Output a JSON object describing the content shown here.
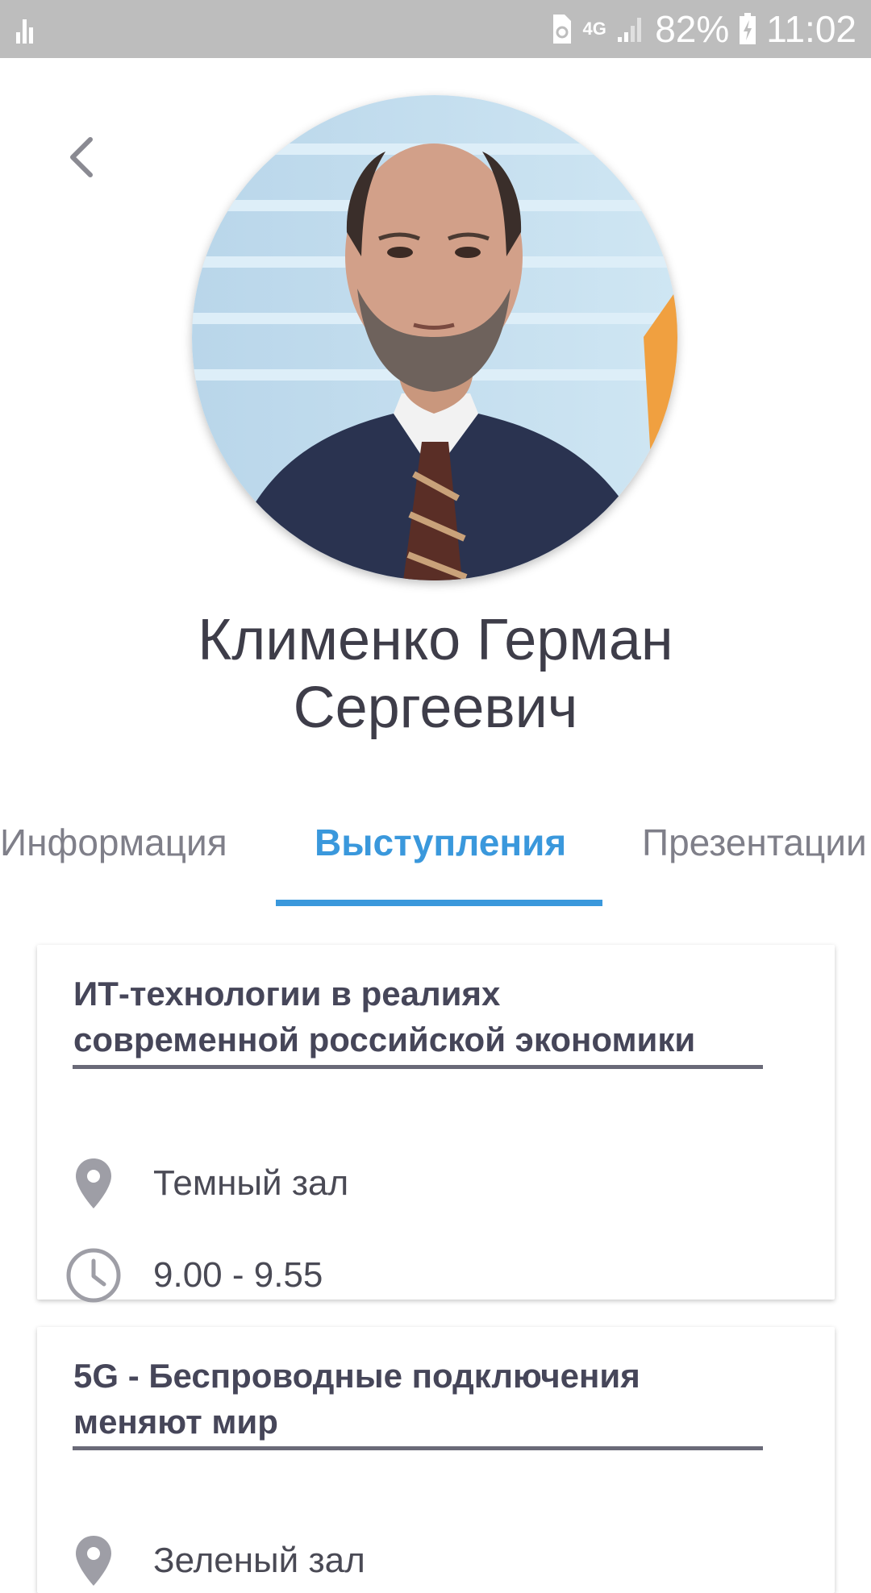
{
  "status_bar": {
    "network": "4G",
    "battery": "82%",
    "time": "11:02"
  },
  "speaker": {
    "name_line1": "Клименко Герман",
    "name_line2": "Сергеевич"
  },
  "tabs": [
    {
      "label": "Информация",
      "active": false
    },
    {
      "label": "Выступления",
      "active": true
    },
    {
      "label": "Презентации",
      "active": false
    }
  ],
  "talks": [
    {
      "title_line1": "ИТ-технологии в реалиях",
      "title_line2": "современной российской экономики",
      "location": "Темный зал",
      "time": "9.00 - 9.55"
    },
    {
      "title_line1": "5G - Беспроводные подключения",
      "title_line2": "меняют мир",
      "location": "Зеленый зал"
    }
  ],
  "colors": {
    "accent": "#3a98dc",
    "text_dark": "#3e3d49",
    "status_bar": "#bdbdbd",
    "icon_gray": "#9e9ea6"
  }
}
